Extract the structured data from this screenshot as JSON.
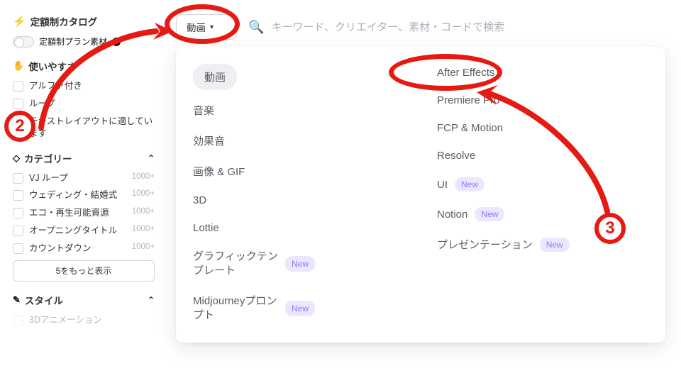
{
  "sidebar": {
    "catalog_title": "定額制カタログ",
    "plan_label": "定額制プラン素材",
    "usability": {
      "title": "使いやすさ",
      "items": [
        {
          "label": "アルファ付き"
        },
        {
          "label": "ループ"
        },
        {
          "label": "テキストレイアウトに適しています"
        }
      ]
    },
    "category": {
      "title": "カテゴリー",
      "items": [
        {
          "label": "VJ ループ",
          "count": "1000+"
        },
        {
          "label": "ウェディング・結婚式",
          "count": "1000+"
        },
        {
          "label": "エコ・再生可能資源",
          "count": "1000+"
        },
        {
          "label": "オープニングタイトル",
          "count": "1000+"
        },
        {
          "label": "カウントダウン",
          "count": "1000+"
        }
      ],
      "show_more": "5をもっと表示"
    },
    "style": {
      "title": "スタイル",
      "items": [
        {
          "label": "3Dアニメーション"
        }
      ]
    }
  },
  "topbar": {
    "type_selected": "動画",
    "search_placeholder": "キーワード、クリエイター、素材・コードで検索"
  },
  "panel": {
    "col1": [
      {
        "label": "動画",
        "pill": true
      },
      {
        "label": "音楽"
      },
      {
        "label": "効果音"
      },
      {
        "label": "画像 & GIF"
      },
      {
        "label": "3D"
      },
      {
        "label": "Lottie"
      },
      {
        "label": "グラフィックテンプレート",
        "new": true,
        "multi": true
      },
      {
        "label": "Midjourneyプロンプト",
        "new": true,
        "multi": true
      }
    ],
    "col2": [
      {
        "label": "After Effects"
      },
      {
        "label": "Premiere Pro"
      },
      {
        "label": "FCP & Motion"
      },
      {
        "label": "Resolve"
      },
      {
        "label": "UI",
        "new": true
      },
      {
        "label": "Notion",
        "new": true
      },
      {
        "label": "プレゼンテーション",
        "new": true
      }
    ],
    "new_text": "New"
  },
  "annotations": {
    "two": "2",
    "three": "3"
  }
}
